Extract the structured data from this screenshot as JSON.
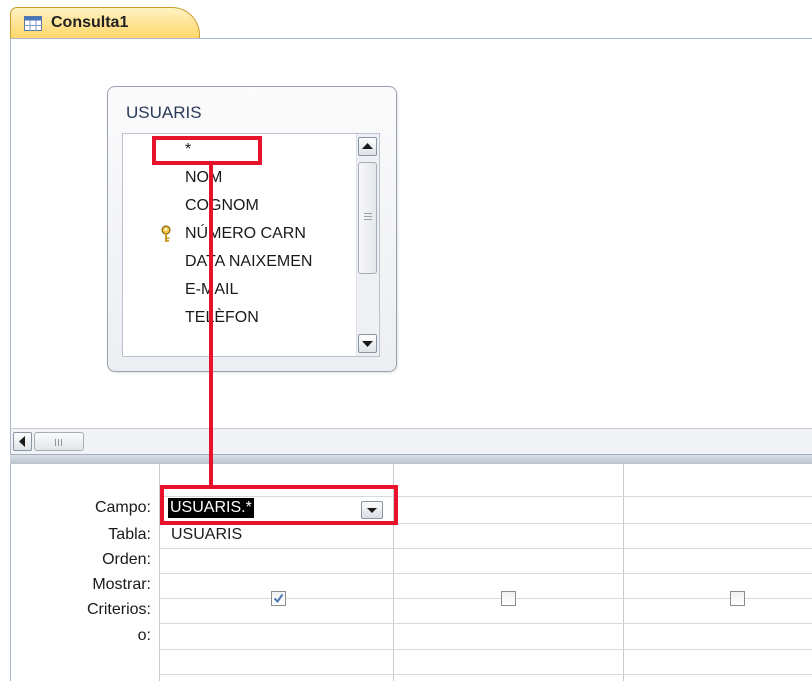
{
  "tab": {
    "label": "Consulta1",
    "icon": "query-icon"
  },
  "table": {
    "title": "USUARIS",
    "fields": [
      "*",
      "NOM",
      "COGNOM",
      "NÚMERO CARN",
      "DATA NAIXEMEN",
      "E-MAIL",
      "TELÈFON"
    ],
    "key_field": "NÚMERO CARN"
  },
  "grid": {
    "row_labels": {
      "campo": "Campo:",
      "tabla": "Tabla:",
      "orden": "Orden:",
      "mostrar": "Mostrar:",
      "criterios": "Criterios:",
      "o": "o:"
    },
    "columns": [
      {
        "campo": "USUARIS.*",
        "tabla": "USUARIS",
        "mostrar": true
      },
      {
        "campo": "",
        "tabla": "",
        "mostrar": false
      },
      {
        "campo": "",
        "tabla": "",
        "mostrar": false
      }
    ]
  },
  "colors": {
    "tab_fill": "#ffd76a",
    "annotation": "#e8122d",
    "selection": "#000000",
    "grid_line": "#c7ccd3"
  }
}
